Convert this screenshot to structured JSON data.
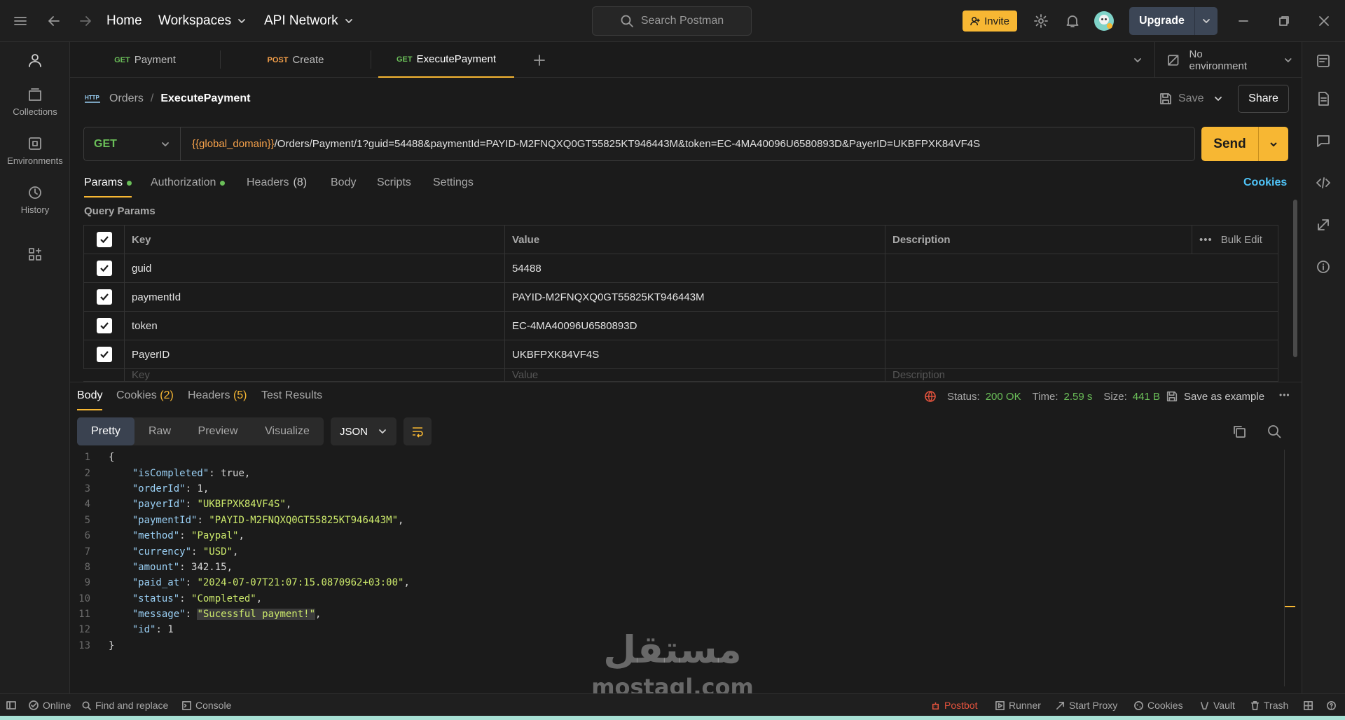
{
  "topbar": {
    "home": "Home",
    "workspaces": "Workspaces",
    "api_network": "API Network",
    "search_placeholder": "Search Postman",
    "invite": "Invite",
    "upgrade": "Upgrade"
  },
  "sidebar": {
    "items": [
      {
        "label": "Collections",
        "icon": "collections-icon"
      },
      {
        "label": "Environments",
        "icon": "environments-icon"
      },
      {
        "label": "History",
        "icon": "history-icon"
      }
    ]
  },
  "tabs": [
    {
      "method": "GET",
      "label": "Payment"
    },
    {
      "method": "POST",
      "label": "Create"
    },
    {
      "method": "GET",
      "label": "ExecutePayment",
      "active": true
    }
  ],
  "environment": "No environment",
  "breadcrumb": {
    "http_badge": "HTTP",
    "parent": "Orders",
    "sep": "/",
    "current": "ExecutePayment"
  },
  "actions": {
    "save": "Save",
    "share": "Share"
  },
  "request": {
    "method": "GET",
    "url_var": "{{global_domain}}",
    "url_rest": "/Orders/Payment/1?guid=54488&paymentId=PAYID-M2FNQXQ0GT55825KT946443M&token=EC-4MA40096U6580893D&PayerID=UKBFPXK84VF4S",
    "send": "Send"
  },
  "request_tabs": {
    "params": "Params",
    "authorization": "Authorization",
    "headers": "Headers",
    "headers_count": "(8)",
    "body": "Body",
    "scripts": "Scripts",
    "settings": "Settings",
    "cookies": "Cookies"
  },
  "query_params": {
    "title": "Query Params",
    "columns": {
      "key": "Key",
      "value": "Value",
      "description": "Description",
      "bulk_edit": "Bulk Edit"
    },
    "rows": [
      {
        "key": "guid",
        "value": "54488"
      },
      {
        "key": "paymentId",
        "value": "PAYID-M2FNQXQ0GT55825KT946443M"
      },
      {
        "key": "token",
        "value": "EC-4MA40096U6580893D"
      },
      {
        "key": "PayerID",
        "value": "UKBFPXK84VF4S"
      }
    ],
    "placeholder_key": "Key",
    "placeholder_value": "Value",
    "placeholder_description": "Description"
  },
  "response": {
    "tabs": {
      "body": "Body",
      "cookies": "Cookies",
      "cookies_count": "(2)",
      "headers": "Headers",
      "headers_count": "(5)",
      "tests": "Test Results"
    },
    "status_label": "Status:",
    "status": "200 OK",
    "time_label": "Time:",
    "time": "2.59 s",
    "size_label": "Size:",
    "size": "441 B",
    "save_example": "Save as example",
    "views": [
      "Pretty",
      "Raw",
      "Preview",
      "Visualize"
    ],
    "format": "JSON",
    "lines": [
      {
        "n": "1",
        "t": "{"
      },
      {
        "n": "2",
        "k": "\"isCompleted\"",
        "v": "true",
        "vt": "b",
        "c": ","
      },
      {
        "n": "3",
        "k": "\"orderId\"",
        "v": "1",
        "vt": "n",
        "c": ","
      },
      {
        "n": "4",
        "k": "\"payerId\"",
        "v": "\"UKBFPXK84VF4S\"",
        "vt": "s",
        "c": ","
      },
      {
        "n": "5",
        "k": "\"paymentId\"",
        "v": "\"PAYID-M2FNQXQ0GT55825KT946443M\"",
        "vt": "s",
        "c": ","
      },
      {
        "n": "6",
        "k": "\"method\"",
        "v": "\"Paypal\"",
        "vt": "s",
        "c": ","
      },
      {
        "n": "7",
        "k": "\"currency\"",
        "v": "\"USD\"",
        "vt": "s",
        "c": ","
      },
      {
        "n": "8",
        "k": "\"amount\"",
        "v": "342.15",
        "vt": "n",
        "c": ","
      },
      {
        "n": "9",
        "k": "\"paid_at\"",
        "v": "\"2024-07-07T21:07:15.0870962+03:00\"",
        "vt": "s",
        "c": ","
      },
      {
        "n": "10",
        "k": "\"status\"",
        "v": "\"Completed\"",
        "vt": "s",
        "c": ","
      },
      {
        "n": "11",
        "k": "\"message\"",
        "v": "\"Sucessful payment!\"",
        "vt": "s",
        "c": ","
      },
      {
        "n": "12",
        "k": "\"id\"",
        "v": "1",
        "vt": "n",
        "c": ""
      },
      {
        "n": "13",
        "t": "}"
      }
    ]
  },
  "watermark": {
    "arabic": "مستقل",
    "latin": "mostaql.com"
  },
  "statusbar": {
    "online": "Online",
    "find_replace": "Find and replace",
    "console": "Console",
    "postbot": "Postbot",
    "runner": "Runner",
    "start_proxy": "Start Proxy",
    "cookies": "Cookies",
    "vault": "Vault",
    "trash": "Trash"
  },
  "colors": {
    "accent": "#f7b733",
    "get": "#6bbf59",
    "post": "#f5a04a",
    "active_tab": "#f7b733"
  }
}
